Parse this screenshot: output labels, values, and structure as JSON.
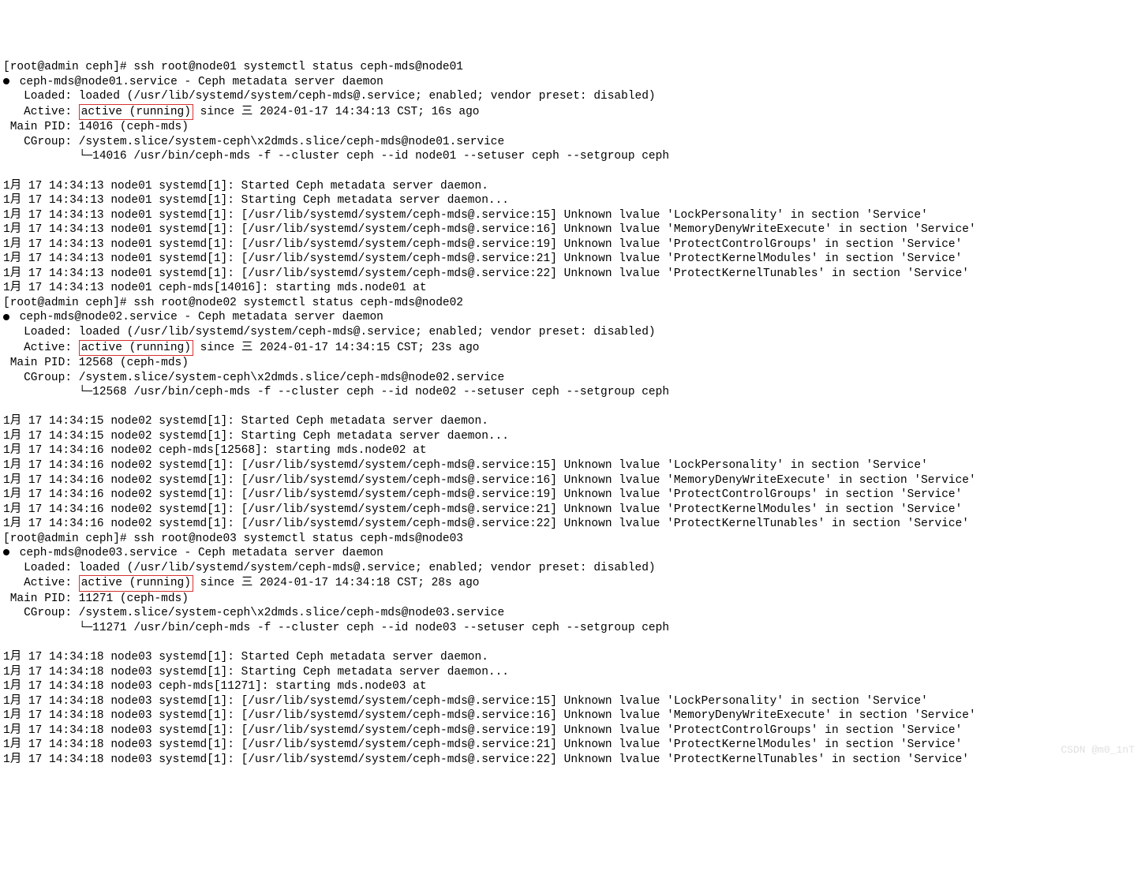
{
  "nodes": [
    {
      "cmd": "[root@admin ceph]# ssh root@node01 systemctl status ceph-mds@node01",
      "unit": " ceph-mds@node01.service - Ceph metadata server daemon",
      "loaded": "   Loaded: loaded (/usr/lib/systemd/system/ceph-mds@.service; enabled; vendor preset: disabled)",
      "active_prefix": "   Active: ",
      "active_highlight": "active (running)",
      "active_suffix": " since 三 2024-01-17 14:34:13 CST; 16s ago",
      "pid": " Main PID: 14016 (ceph-mds)",
      "cgroup": "   CGroup: /system.slice/system-ceph\\x2dmds.slice/ceph-mds@node01.service",
      "cgtree": "           └─14016 /usr/bin/ceph-mds -f --cluster ceph --id node01 --setuser ceph --setgroup ceph",
      "logs": [
        "1月 17 14:34:13 node01 systemd[1]: Started Ceph metadata server daemon.",
        "1月 17 14:34:13 node01 systemd[1]: Starting Ceph metadata server daemon...",
        "1月 17 14:34:13 node01 systemd[1]: [/usr/lib/systemd/system/ceph-mds@.service:15] Unknown lvalue 'LockPersonality' in section 'Service'",
        "1月 17 14:34:13 node01 systemd[1]: [/usr/lib/systemd/system/ceph-mds@.service:16] Unknown lvalue 'MemoryDenyWriteExecute' in section 'Service'",
        "1月 17 14:34:13 node01 systemd[1]: [/usr/lib/systemd/system/ceph-mds@.service:19] Unknown lvalue 'ProtectControlGroups' in section 'Service'",
        "1月 17 14:34:13 node01 systemd[1]: [/usr/lib/systemd/system/ceph-mds@.service:21] Unknown lvalue 'ProtectKernelModules' in section 'Service'",
        "1月 17 14:34:13 node01 systemd[1]: [/usr/lib/systemd/system/ceph-mds@.service:22] Unknown lvalue 'ProtectKernelTunables' in section 'Service'",
        "1月 17 14:34:13 node01 ceph-mds[14016]: starting mds.node01 at"
      ]
    },
    {
      "cmd": "[root@admin ceph]# ssh root@node02 systemctl status ceph-mds@node02",
      "unit": " ceph-mds@node02.service - Ceph metadata server daemon",
      "loaded": "   Loaded: loaded (/usr/lib/systemd/system/ceph-mds@.service; enabled; vendor preset: disabled)",
      "active_prefix": "   Active: ",
      "active_highlight": "active (running)",
      "active_suffix": " since 三 2024-01-17 14:34:15 CST; 23s ago",
      "pid": " Main PID: 12568 (ceph-mds)",
      "cgroup": "   CGroup: /system.slice/system-ceph\\x2dmds.slice/ceph-mds@node02.service",
      "cgtree": "           └─12568 /usr/bin/ceph-mds -f --cluster ceph --id node02 --setuser ceph --setgroup ceph",
      "logs": [
        "1月 17 14:34:15 node02 systemd[1]: Started Ceph metadata server daemon.",
        "1月 17 14:34:15 node02 systemd[1]: Starting Ceph metadata server daemon...",
        "1月 17 14:34:16 node02 ceph-mds[12568]: starting mds.node02 at",
        "1月 17 14:34:16 node02 systemd[1]: [/usr/lib/systemd/system/ceph-mds@.service:15] Unknown lvalue 'LockPersonality' in section 'Service'",
        "1月 17 14:34:16 node02 systemd[1]: [/usr/lib/systemd/system/ceph-mds@.service:16] Unknown lvalue 'MemoryDenyWriteExecute' in section 'Service'",
        "1月 17 14:34:16 node02 systemd[1]: [/usr/lib/systemd/system/ceph-mds@.service:19] Unknown lvalue 'ProtectControlGroups' in section 'Service'",
        "1月 17 14:34:16 node02 systemd[1]: [/usr/lib/systemd/system/ceph-mds@.service:21] Unknown lvalue 'ProtectKernelModules' in section 'Service'",
        "1月 17 14:34:16 node02 systemd[1]: [/usr/lib/systemd/system/ceph-mds@.service:22] Unknown lvalue 'ProtectKernelTunables' in section 'Service'"
      ]
    },
    {
      "cmd": "[root@admin ceph]# ssh root@node03 systemctl status ceph-mds@node03",
      "unit": " ceph-mds@node03.service - Ceph metadata server daemon",
      "loaded": "   Loaded: loaded (/usr/lib/systemd/system/ceph-mds@.service; enabled; vendor preset: disabled)",
      "active_prefix": "   Active: ",
      "active_highlight": "active (running)",
      "active_suffix": " since 三 2024-01-17 14:34:18 CST; 28s ago",
      "pid": " Main PID: 11271 (ceph-mds)",
      "cgroup": "   CGroup: /system.slice/system-ceph\\x2dmds.slice/ceph-mds@node03.service",
      "cgtree": "           └─11271 /usr/bin/ceph-mds -f --cluster ceph --id node03 --setuser ceph --setgroup ceph",
      "logs": [
        "1月 17 14:34:18 node03 systemd[1]: Started Ceph metadata server daemon.",
        "1月 17 14:34:18 node03 systemd[1]: Starting Ceph metadata server daemon...",
        "1月 17 14:34:18 node03 ceph-mds[11271]: starting mds.node03 at",
        "1月 17 14:34:18 node03 systemd[1]: [/usr/lib/systemd/system/ceph-mds@.service:15] Unknown lvalue 'LockPersonality' in section 'Service'",
        "1月 17 14:34:18 node03 systemd[1]: [/usr/lib/systemd/system/ceph-mds@.service:16] Unknown lvalue 'MemoryDenyWriteExecute' in section 'Service'",
        "1月 17 14:34:18 node03 systemd[1]: [/usr/lib/systemd/system/ceph-mds@.service:19] Unknown lvalue 'ProtectControlGroups' in section 'Service'",
        "1月 17 14:34:18 node03 systemd[1]: [/usr/lib/systemd/system/ceph-mds@.service:21] Unknown lvalue 'ProtectKernelModules' in section 'Service'",
        "1月 17 14:34:18 node03 systemd[1]: [/usr/lib/systemd/system/ceph-mds@.service:22] Unknown lvalue 'ProtectKernelTunables' in section 'Service'"
      ]
    }
  ],
  "watermark": "CSDN @m0_1nT"
}
